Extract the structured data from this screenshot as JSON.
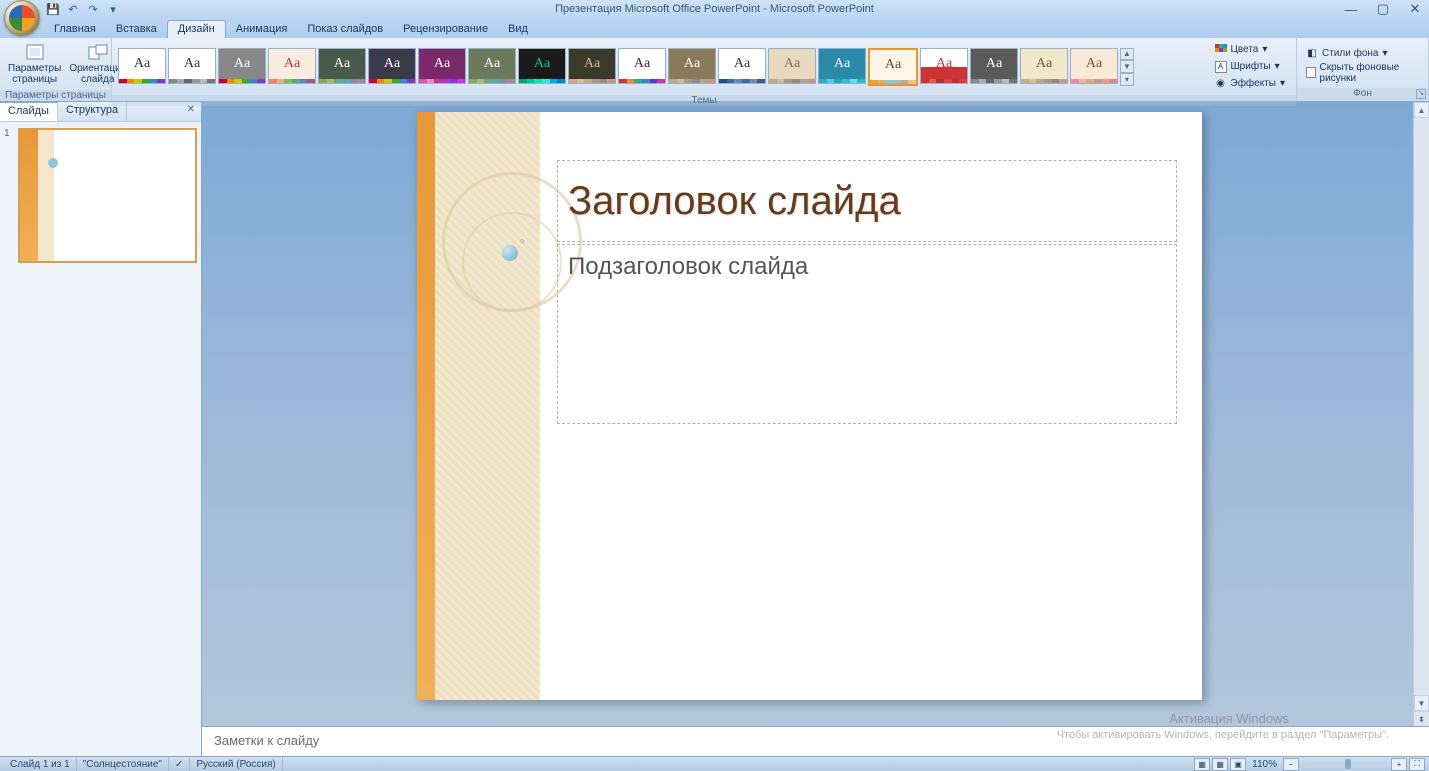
{
  "app": {
    "title": "Презентация Microsoft Office PowerPoint - Microsoft PowerPoint"
  },
  "qat": {
    "save": "💾",
    "undo": "↶",
    "redo": "↷"
  },
  "tabs": {
    "home": "Главная",
    "insert": "Вставка",
    "design": "Дизайн",
    "animation": "Анимация",
    "slideshow": "Показ слайдов",
    "review": "Рецензирование",
    "view": "Вид"
  },
  "ribbon": {
    "page_params": {
      "page_setup": "Параметры\nстраницы",
      "orientation": "Ориентация\nслайда",
      "group_label": "Параметры страницы"
    },
    "themes": {
      "group_label": "Темы",
      "colors": "Цвета",
      "fonts": "Шрифты",
      "effects": "Эффекты"
    },
    "background": {
      "styles": "Стили фона",
      "hide_bg": "Скрыть фоновые рисунки",
      "group_label": "Фон"
    }
  },
  "panel": {
    "slides_tab": "Слайды",
    "outline_tab": "Структура",
    "thumb_num": "1"
  },
  "slide": {
    "title": "Заголовок слайда",
    "subtitle": "Подзаголовок слайда"
  },
  "notes": {
    "placeholder": "Заметки к слайду"
  },
  "watermark": {
    "line1": "Активация Windows",
    "line2": "Чтобы активировать Windows, перейдите в раздел \"Параметры\"."
  },
  "status": {
    "slide_info": "Слайд 1 из 1",
    "theme_name": "\"Солнцестояние\"",
    "language": "Русский (Россия)",
    "zoom": "110%"
  }
}
